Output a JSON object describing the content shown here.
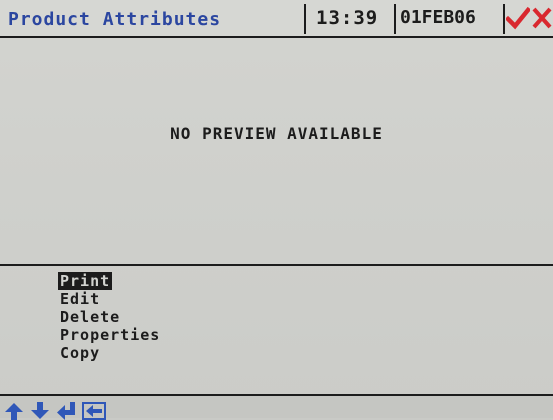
{
  "header": {
    "title": "Product Attributes",
    "time": "13:39",
    "date": "01FEB06"
  },
  "preview": {
    "message": "NO PREVIEW AVAILABLE"
  },
  "menu": {
    "items": [
      {
        "label": "Print",
        "selected": true
      },
      {
        "label": "Edit",
        "selected": false
      },
      {
        "label": "Delete",
        "selected": false
      },
      {
        "label": "Properties",
        "selected": false
      },
      {
        "label": "Copy",
        "selected": false
      }
    ]
  },
  "footer": {
    "icons": [
      "arrow-up-icon",
      "arrow-down-icon",
      "enter-icon",
      "back-icon"
    ]
  },
  "colors": {
    "title": "#2b46a0",
    "confirm": "#d9282f",
    "cancel": "#d9282f",
    "nav_icons": "#2f57b8"
  }
}
